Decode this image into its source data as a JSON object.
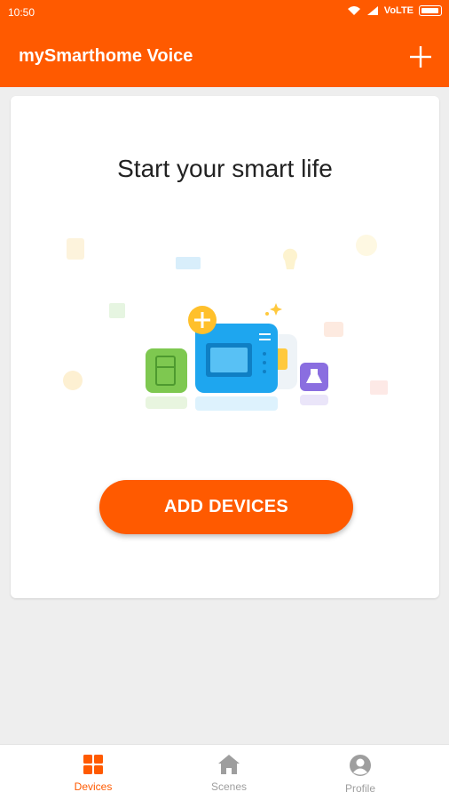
{
  "status_bar": {
    "time": "10:50",
    "network": "VoLTE"
  },
  "app_bar": {
    "title": "mySmarthome Voice"
  },
  "card": {
    "headline": "Start your smart life",
    "add_button_label": "ADD DEVICES"
  },
  "bottom_nav": [
    {
      "label": "Devices",
      "icon": "devices-grid-icon",
      "active": true
    },
    {
      "label": "Scenes",
      "icon": "home-icon",
      "active": false
    },
    {
      "label": "Profile",
      "icon": "profile-icon",
      "active": false
    }
  ],
  "colors": {
    "accent": "#ff5a00",
    "background": "#eeeeee",
    "inactive": "#9e9e9e"
  }
}
